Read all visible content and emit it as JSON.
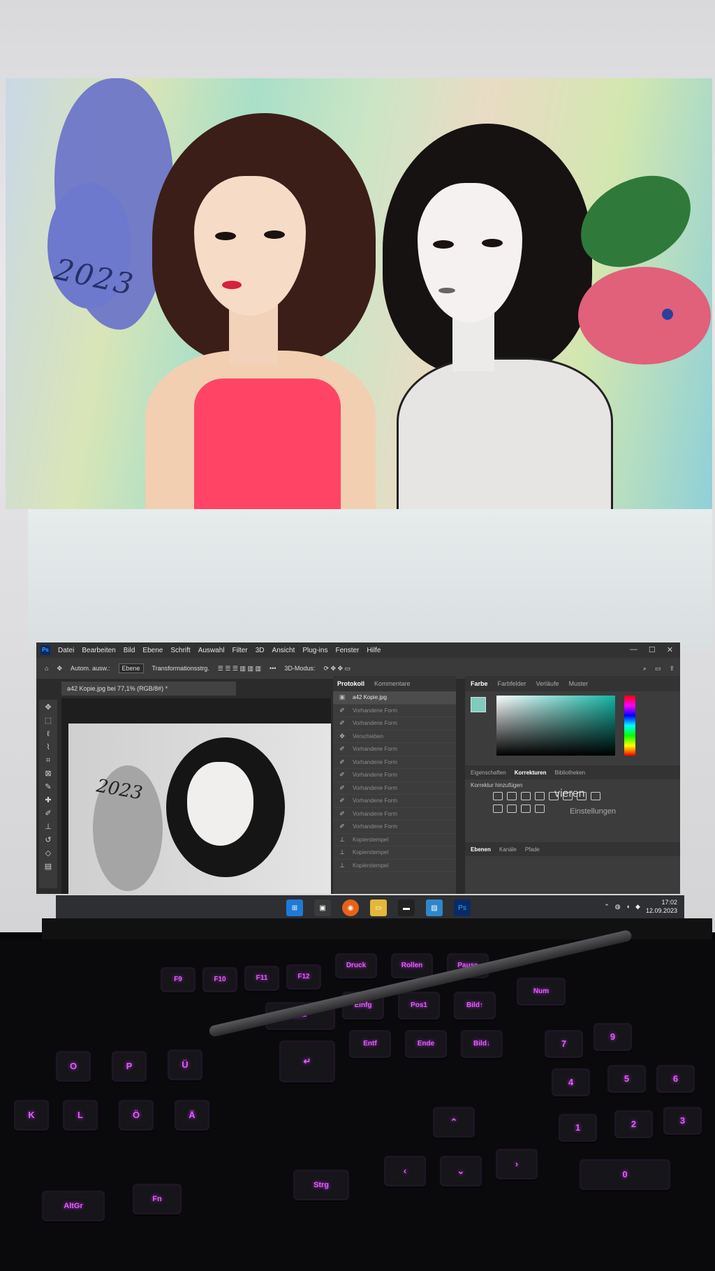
{
  "artwork": {
    "year": "2023"
  },
  "photoshop": {
    "menu": [
      "Datei",
      "Bearbeiten",
      "Bild",
      "Ebene",
      "Schrift",
      "Auswahl",
      "Filter",
      "3D",
      "Ansicht",
      "Plug-ins",
      "Fenster",
      "Hilfe"
    ],
    "options": {
      "autoselect": "Autom. ausw.:",
      "layer": "Ebene",
      "transform": "Transformationsstrg.",
      "mode3d": "3D-Modus:"
    },
    "doc_tab": "a42 Kopie.jpg bei 77,1% (RGB/8#) *",
    "history": {
      "tabs": [
        "Protokoll",
        "Kommentare"
      ],
      "snapshot": "a42 Kopie.jpg",
      "items": [
        {
          "icon": "brush",
          "label": "Vorhandene Form"
        },
        {
          "icon": "brush",
          "label": "Vorhandene Form"
        },
        {
          "icon": "move",
          "label": "Verschieben"
        },
        {
          "icon": "brush",
          "label": "Vorhandene Form"
        },
        {
          "icon": "brush",
          "label": "Vorhandene Form"
        },
        {
          "icon": "brush",
          "label": "Vorhandene Form"
        },
        {
          "icon": "brush",
          "label": "Vorhandene Form"
        },
        {
          "icon": "brush",
          "label": "Vorhandene Form"
        },
        {
          "icon": "brush",
          "label": "Vorhandene Form"
        },
        {
          "icon": "brush",
          "label": "Vorhandene Form"
        },
        {
          "icon": "stamp",
          "label": "Kopierstempel"
        },
        {
          "icon": "stamp",
          "label": "Kopierstempel"
        },
        {
          "icon": "stamp",
          "label": "Kopierstempel"
        }
      ]
    },
    "color_tabs": [
      "Farbe",
      "Farbfelder",
      "Verläufe",
      "Muster"
    ],
    "adjust_tabs": [
      "Eigenschaften",
      "Korrekturen",
      "Bibliotheken"
    ],
    "adjust_title": "Korrektur hinzufügen",
    "overlay_text": "vieren",
    "overlay_text2": "Einstellungen",
    "layers_tabs": [
      "Ebenen",
      "Kanäle",
      "Pfade"
    ]
  },
  "taskbar": {
    "apps": [
      "windows-start",
      "file-explorer",
      "firefox",
      "folder",
      "terminal",
      "photos",
      "photoshop"
    ],
    "time": "17:02",
    "date": "12.09.2023"
  },
  "keyboard": {
    "keys_top": [
      "Druck",
      "Rollen",
      "Pause"
    ],
    "keys_nav": [
      "Einfg",
      "Pos1",
      "Bild↑",
      "Entf",
      "Ende",
      "Bild↓"
    ],
    "keys_fn": [
      "F9",
      "F10",
      "F11",
      "F12"
    ],
    "keys_misc": [
      "Num",
      "Strg",
      "AltGr",
      "Fn"
    ]
  },
  "colors": {
    "accent": "#e060f0",
    "ps_blue": "#31a8ff"
  }
}
